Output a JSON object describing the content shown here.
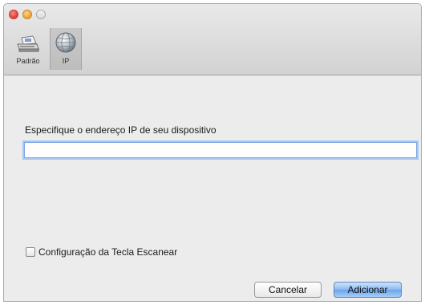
{
  "window": {
    "controls": [
      "close",
      "minimize",
      "zoom"
    ]
  },
  "toolbar": {
    "tabs": [
      {
        "label": "Padrão",
        "icon": "scanner-icon",
        "selected": false
      },
      {
        "label": "IP",
        "icon": "network-globe-icon",
        "selected": true
      }
    ]
  },
  "form": {
    "ip_label": "Especifique o endereço IP de seu dispositivo",
    "ip_value": "",
    "scan_key_label": "Configuração da Tecla Escanear",
    "scan_key_checked": false
  },
  "buttons": {
    "cancel": "Cancelar",
    "add": "Adicionar"
  },
  "colors": {
    "accent": "#6aa3ea",
    "focus_ring": "#a9c7f2"
  }
}
